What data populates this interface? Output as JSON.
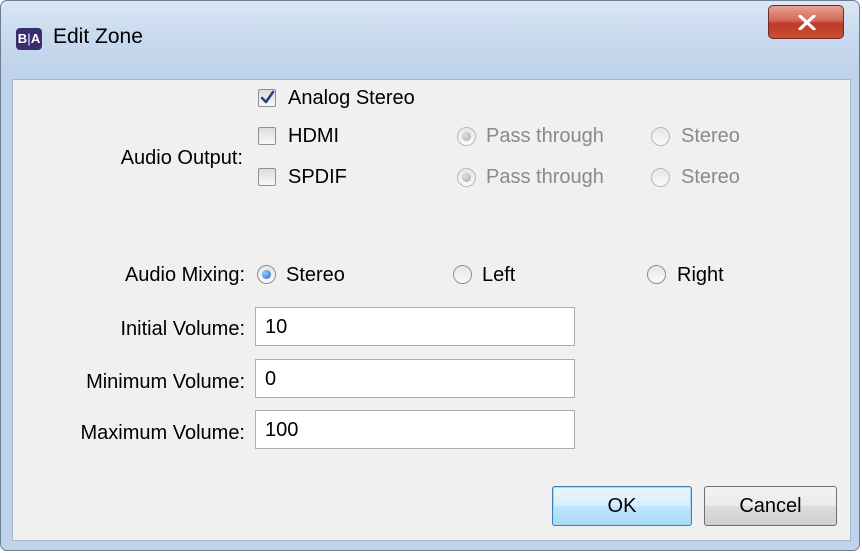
{
  "window": {
    "title": "Edit Zone",
    "app_icon_left": "B",
    "app_icon_sep": "|",
    "app_icon_right": "A"
  },
  "audio_output": {
    "label": "Audio Output:",
    "analog_stereo": {
      "label": "Analog Stereo",
      "checked": true
    },
    "hdmi": {
      "label": "HDMI",
      "checked": false,
      "pass_through": "Pass through",
      "stereo": "Stereo",
      "selected": "Pass through",
      "enabled": false
    },
    "spdif": {
      "label": "SPDIF",
      "checked": false,
      "pass_through": "Pass through",
      "stereo": "Stereo",
      "selected": "Pass through",
      "enabled": false
    }
  },
  "audio_mixing": {
    "label": "Audio Mixing:",
    "options": [
      "Stereo",
      "Left",
      "Right"
    ],
    "selected": "Stereo"
  },
  "volume": {
    "initial_label": "Initial Volume:",
    "initial_value": "10",
    "minimum_label": "Minimum Volume:",
    "minimum_value": "0",
    "maximum_label": "Maximum Volume:",
    "maximum_value": "100"
  },
  "buttons": {
    "ok": "OK",
    "cancel": "Cancel"
  },
  "colors": {
    "titlebar": "#c7d9ee",
    "close_button": "#c8472f",
    "radio_selected": "#1c66c8",
    "disabled_text": "#8a8a8a"
  },
  "icons": {
    "close": "close-x-icon",
    "check": "checkmark-icon",
    "app": "ba-app-icon"
  }
}
